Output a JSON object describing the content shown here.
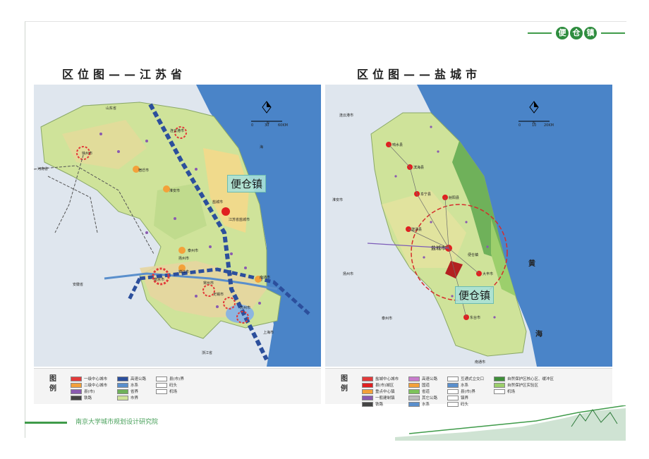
{
  "brand": {
    "name": "便仓镇",
    "chars": [
      "便",
      "仓",
      "镇"
    ]
  },
  "left_panel": {
    "title": "区位图——江苏省",
    "callout": "便仓镇",
    "compass": {
      "north": "N",
      "scale": [
        "0",
        "30",
        "60KM"
      ]
    },
    "place_labels": [
      "山东省",
      "连云港市",
      "徐州市",
      "宿迁市",
      "淮安市",
      "盐城市",
      "泰州市",
      "扬州市",
      "镇江市",
      "南京市",
      "常州市",
      "无锡市",
      "苏州市",
      "南通市",
      "上海市",
      "安徽省",
      "浙江省",
      "河南省",
      "海",
      "江苏省盐城市"
    ]
  },
  "right_panel": {
    "title": "区位图——盐城市",
    "callout": "便仓镇",
    "compass": {
      "north": "N",
      "scale": [
        "0",
        "10",
        "20KM"
      ]
    },
    "place_labels": [
      "连云港市",
      "淮安市",
      "扬州市",
      "泰州市",
      "南通市",
      "盐城市",
      "便仓镇",
      "黄",
      "海",
      "大丰市",
      "东台市",
      "响水县",
      "滨海县",
      "阜宁县",
      "射阳县",
      "建湖县"
    ]
  },
  "legend_left": {
    "heading": "图例",
    "items": [
      "一级中心城市",
      "高速公路",
      "县(市)界",
      "二级中心城市",
      "水系",
      "码头",
      "县(市)",
      "省界",
      "机场",
      "铁路",
      "市界",
      ""
    ]
  },
  "legend_right": {
    "heading": "图例",
    "items": [
      "盐城中心城市",
      "高速公路",
      "互通式立交口",
      "自然保护区核心区、缓冲区",
      "县(市)城区",
      "国道",
      "水系",
      "自然保护区实验区",
      "重点中心镇",
      "省道",
      "县(市)界",
      "机场",
      "一般建制镇",
      "其它公路",
      "镇界",
      "",
      "铁路",
      "水系",
      "码头",
      ""
    ]
  },
  "footer": {
    "institute": "南京大学城市规划设计研究院"
  },
  "colors": {
    "accent": "#3f9b4a",
    "sea": "#3a79c4",
    "land": "#cfe39a",
    "callout": "#aae1d7"
  }
}
